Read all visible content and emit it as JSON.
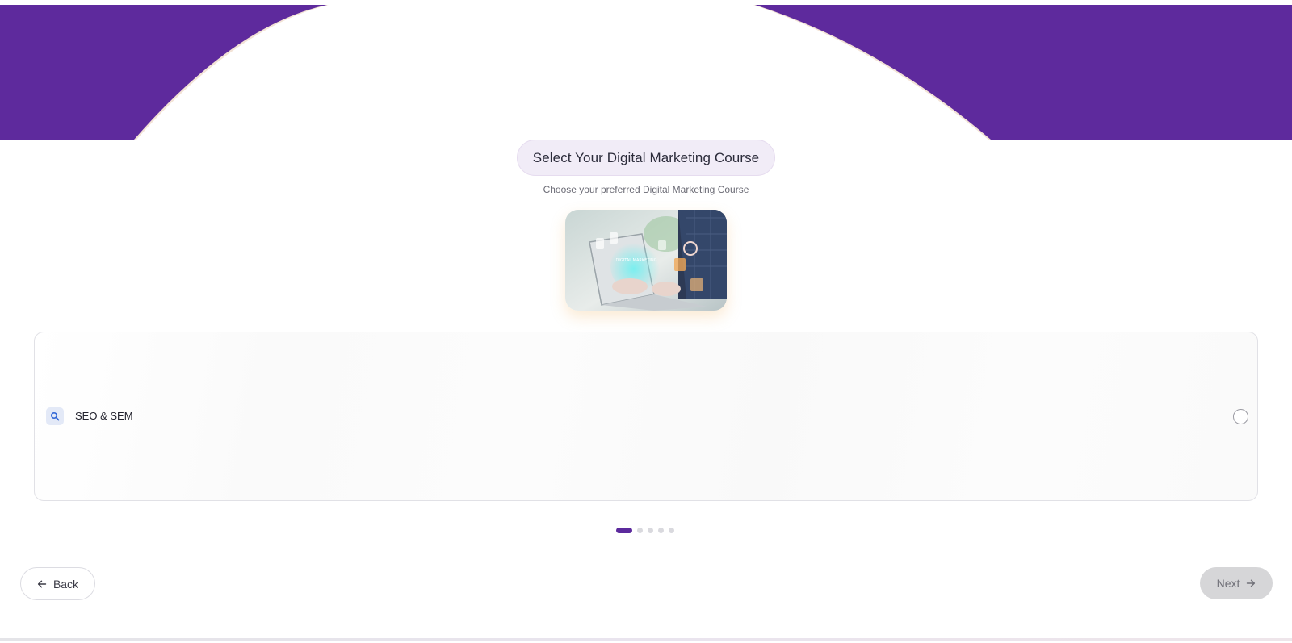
{
  "colors": {
    "brand_purple": "#5e2a9d",
    "dot_active": "#5c2a9d",
    "next_disabled": "#d6d6d8"
  },
  "header": {
    "title": "Select Your Digital Marketing Course",
    "subtitle": "Choose your preferred Digital Marketing Course"
  },
  "hero_image": {
    "icon": "laptop-digital-marketing-photo",
    "caption_text": "DIGITAL MARKETING"
  },
  "options": [
    {
      "label": "SEO & SEM",
      "icon": "search-icon",
      "selected": false
    }
  ],
  "pagination": {
    "current": 1,
    "total": 5
  },
  "nav": {
    "back_label": "Back",
    "back_icon": "arrow-left-icon",
    "next_label": "Next",
    "next_icon": "arrow-right-icon",
    "next_enabled": false
  }
}
